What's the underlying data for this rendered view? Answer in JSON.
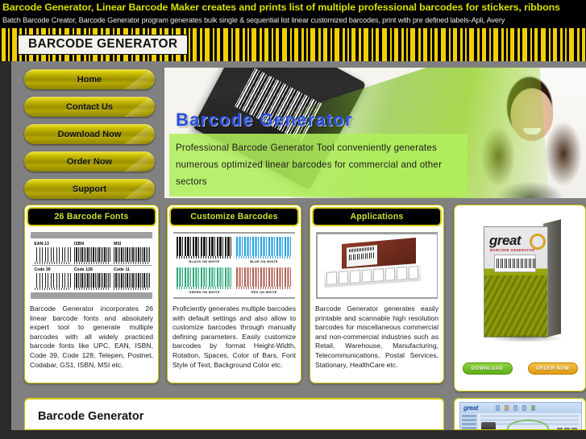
{
  "seo": {
    "headline": "Barcode Generator, Linear Barcode Maker creates and prints list of multiple professional barcodes for stickers, ribbons",
    "subline": "Batch Barcode Creator, Barcode Generator program generates bulk single & sequential list linear customized barcodes, print with pre defined labels-Apli, Avery"
  },
  "header": {
    "site_title": "BARCODE GENERATOR"
  },
  "nav": {
    "items": [
      {
        "label": "Home"
      },
      {
        "label": "Contact Us"
      },
      {
        "label": "Download Now"
      },
      {
        "label": "Order Now"
      },
      {
        "label": "Support"
      }
    ]
  },
  "banner": {
    "heading": "Barcode Generator",
    "description": "Professional Barcode Generator Tool conveniently generates numerous optimized linear barcodes for commercial and other sectors"
  },
  "panels": [
    {
      "title": "26 Barcode Fonts",
      "body": "Barcode Generator incorporates 26 linear barcode fonts and absolutely expert tool to generate multiple barcodes with all widely practiced barcode fonts like UPC, EAN, ISBN, Code 39, Code 128, Telepen, Postnet, Codabar, GS1, ISBN, MSI etc.",
      "fonts": [
        {
          "name": "EAN-13"
        },
        {
          "name": "ISBN"
        },
        {
          "name": "MSI"
        },
        {
          "name": "Code 39"
        },
        {
          "name": "Code 128"
        },
        {
          "name": "Code 11"
        }
      ]
    },
    {
      "title": "Customize Barcodes",
      "body": "Proficiently generates multiple barcodes with default settings and also allow to customize barcodes through manually defining parameters. Easily customize barcodes by format Height-Width, Rotation, Spaces, Color of Bars, Font Style of Text, Background Color etc.",
      "samples": [
        {
          "label": "BLACK ON WHITE",
          "color": "#1f1f1f"
        },
        {
          "label": "BLUE ON WHITE",
          "color": "#2f9fe0"
        },
        {
          "label": "GREEN ON WHITE",
          "color": "#2fa777"
        },
        {
          "label": "RED ON WHITE",
          "color": "#b06558"
        }
      ]
    },
    {
      "title": "Applications",
      "body": "Barcode Generator generates easily printable and scannable high resolution barcodes for miscellaneous commercial and non-commercial industries such as Retail, Warehouse, Manufacturing, Telecommunications, Postal Services, Stationary, HealthCare etc."
    }
  ],
  "product": {
    "box_brand": "great",
    "box_subtitle": "BARCODE GENERATOR",
    "download_label": "DOWNLOAD",
    "order_label": "ORDER NOW"
  },
  "bottom": {
    "section_title": "Barcode Generator",
    "screenshot_logo": "great"
  },
  "colors": {
    "accent_yellow": "#d6cf11",
    "headline_yellow": "#d8e000",
    "panel_title_green": "#c9e034",
    "banner_blue": "#2a4fd6",
    "banner_green": "#b0ee5c",
    "page_gray": "#808080",
    "page_dark": "#2b2b2b"
  }
}
